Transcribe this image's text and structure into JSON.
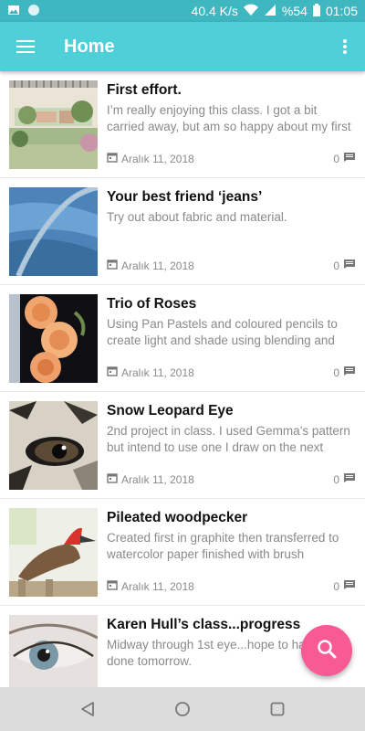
{
  "status_bar": {
    "speed": "40.4 K/s",
    "battery": "%54",
    "time": "01:05",
    "icons": [
      "image-icon",
      "circle-app-icon",
      "wifi-icon",
      "signal-icon",
      "battery-icon"
    ]
  },
  "app_bar": {
    "title": "Home",
    "menu_icon": "hamburger-menu-icon",
    "more_icon": "more-vert-icon",
    "background": "#4fd0d8"
  },
  "items": [
    {
      "title": "First effort.",
      "description": "I’m really enjoying this class. I got a bit carried away, but am so happy about my first",
      "date": "Aralık 11, 2018",
      "comments": "0",
      "thumb": "watercolor-park-sketch"
    },
    {
      "title": "Your best friend ‘jeans’",
      "description": "Try out about fabric and material.",
      "date": "Aralık 11, 2018",
      "comments": "0",
      "thumb": "jeans-denim-drawing"
    },
    {
      "title": "Trio of Roses",
      "description": "Using Pan Pastels and coloured pencils to create light and shade using blending and",
      "date": "Aralık 11, 2018",
      "comments": "0",
      "thumb": "orange-roses-drawing"
    },
    {
      "title": "Snow Leopard Eye",
      "description": "2nd project in class. I used Gemma’s pattern but intend to use one I draw on the next",
      "date": "Aralık 11, 2018",
      "comments": "0",
      "thumb": "leopard-eye-drawing"
    },
    {
      "title": "Pileated woodpecker",
      "description": "Created first in graphite then transferred to watercolor paper finished with brush",
      "date": "Aralık 11, 2018",
      "comments": "0",
      "thumb": "woodpecker-painting"
    },
    {
      "title": "Karen Hull’s class...progress",
      "description": "Midway through 1st eye...hope to have it done tomorrow.",
      "date": "",
      "comments": "",
      "thumb": "human-eye-drawing"
    }
  ],
  "fab": {
    "icon": "search-icon",
    "color": "#f85a94"
  },
  "nav": {
    "back_icon": "back-triangle-icon",
    "home_icon": "home-circle-icon",
    "recents_icon": "recents-square-icon"
  }
}
